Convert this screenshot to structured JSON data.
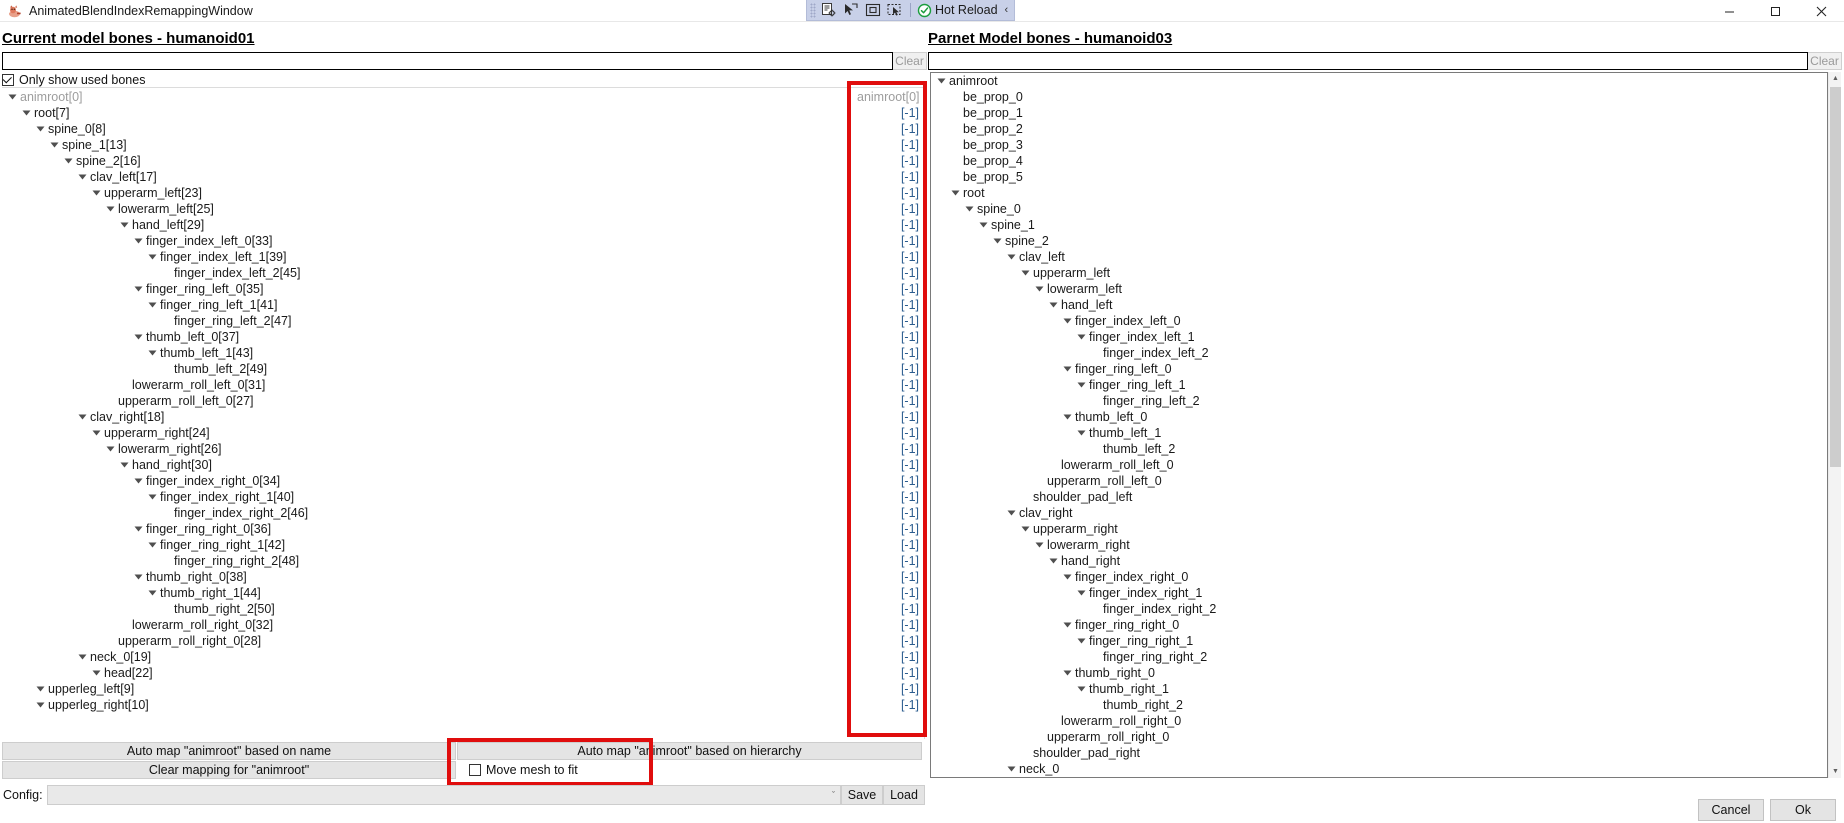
{
  "window": {
    "title": "AnimatedBlendIndexRemappingWindow",
    "icon": "app-icon",
    "minimize": "—",
    "maximize": "☐",
    "close": "✕"
  },
  "toolbar": {
    "buttons": [
      {
        "name": "select-element-icon",
        "label": ""
      },
      {
        "name": "pointer-icon",
        "label": ""
      },
      {
        "name": "frame-icon",
        "label": ""
      },
      {
        "name": "preview-selection-icon",
        "label": ""
      }
    ],
    "hot_reload": "Hot Reload",
    "overflow": "‹"
  },
  "left_panel": {
    "title": "Current model bones - humanoid01",
    "filter_value": "",
    "filter_placeholder": "",
    "clear_label": "Clear",
    "only_used_label": "Only show used bones",
    "only_used_checked": true,
    "tree": [
      {
        "label": "animroot[0]",
        "depth": 0,
        "arrow": true,
        "dim": true
      },
      {
        "label": "root[7]",
        "depth": 1,
        "arrow": true,
        "dim": false
      },
      {
        "label": "spine_0[8]",
        "depth": 2,
        "arrow": true,
        "dim": false
      },
      {
        "label": "spine_1[13]",
        "depth": 3,
        "arrow": true,
        "dim": false
      },
      {
        "label": "spine_2[16]",
        "depth": 4,
        "arrow": true,
        "dim": false
      },
      {
        "label": "clav_left[17]",
        "depth": 5,
        "arrow": true,
        "dim": false
      },
      {
        "label": "upperarm_left[23]",
        "depth": 6,
        "arrow": true,
        "dim": false
      },
      {
        "label": "lowerarm_left[25]",
        "depth": 7,
        "arrow": true,
        "dim": false
      },
      {
        "label": "hand_left[29]",
        "depth": 8,
        "arrow": true,
        "dim": false
      },
      {
        "label": "finger_index_left_0[33]",
        "depth": 9,
        "arrow": true,
        "dim": false
      },
      {
        "label": "finger_index_left_1[39]",
        "depth": 10,
        "arrow": true,
        "dim": false
      },
      {
        "label": "finger_index_left_2[45]",
        "depth": 11,
        "arrow": false,
        "dim": false
      },
      {
        "label": "finger_ring_left_0[35]",
        "depth": 9,
        "arrow": true,
        "dim": false
      },
      {
        "label": "finger_ring_left_1[41]",
        "depth": 10,
        "arrow": true,
        "dim": false
      },
      {
        "label": "finger_ring_left_2[47]",
        "depth": 11,
        "arrow": false,
        "dim": false
      },
      {
        "label": "thumb_left_0[37]",
        "depth": 9,
        "arrow": true,
        "dim": false
      },
      {
        "label": "thumb_left_1[43]",
        "depth": 10,
        "arrow": true,
        "dim": false
      },
      {
        "label": "thumb_left_2[49]",
        "depth": 11,
        "arrow": false,
        "dim": false
      },
      {
        "label": "lowerarm_roll_left_0[31]",
        "depth": 8,
        "arrow": false,
        "dim": false
      },
      {
        "label": "upperarm_roll_left_0[27]",
        "depth": 7,
        "arrow": false,
        "dim": false
      },
      {
        "label": "clav_right[18]",
        "depth": 5,
        "arrow": true,
        "dim": false
      },
      {
        "label": "upperarm_right[24]",
        "depth": 6,
        "arrow": true,
        "dim": false
      },
      {
        "label": "lowerarm_right[26]",
        "depth": 7,
        "arrow": true,
        "dim": false
      },
      {
        "label": "hand_right[30]",
        "depth": 8,
        "arrow": true,
        "dim": false
      },
      {
        "label": "finger_index_right_0[34]",
        "depth": 9,
        "arrow": true,
        "dim": false
      },
      {
        "label": "finger_index_right_1[40]",
        "depth": 10,
        "arrow": true,
        "dim": false
      },
      {
        "label": "finger_index_right_2[46]",
        "depth": 11,
        "arrow": false,
        "dim": false
      },
      {
        "label": "finger_ring_right_0[36]",
        "depth": 9,
        "arrow": true,
        "dim": false
      },
      {
        "label": "finger_ring_right_1[42]",
        "depth": 10,
        "arrow": true,
        "dim": false
      },
      {
        "label": "finger_ring_right_2[48]",
        "depth": 11,
        "arrow": false,
        "dim": false
      },
      {
        "label": "thumb_right_0[38]",
        "depth": 9,
        "arrow": true,
        "dim": false
      },
      {
        "label": "thumb_right_1[44]",
        "depth": 10,
        "arrow": true,
        "dim": false
      },
      {
        "label": "thumb_right_2[50]",
        "depth": 11,
        "arrow": false,
        "dim": false
      },
      {
        "label": "lowerarm_roll_right_0[32]",
        "depth": 8,
        "arrow": false,
        "dim": false
      },
      {
        "label": "upperarm_roll_right_0[28]",
        "depth": 7,
        "arrow": false,
        "dim": false
      },
      {
        "label": "neck_0[19]",
        "depth": 5,
        "arrow": true,
        "dim": false
      },
      {
        "label": "head[22]",
        "depth": 6,
        "arrow": true,
        "dim": false
      },
      {
        "label": "upperleg_left[9]",
        "depth": 2,
        "arrow": true,
        "dim": false
      },
      {
        "label": "upperleg_right[10]",
        "depth": 2,
        "arrow": true,
        "dim": false
      }
    ],
    "index_column": [
      {
        "label": "animroot[0]",
        "dim": true
      },
      {
        "label": "[-1]",
        "dim": false
      },
      {
        "label": "[-1]",
        "dim": false
      },
      {
        "label": "[-1]",
        "dim": false
      },
      {
        "label": "[-1]",
        "dim": false
      },
      {
        "label": "[-1]",
        "dim": false
      },
      {
        "label": "[-1]",
        "dim": false
      },
      {
        "label": "[-1]",
        "dim": false
      },
      {
        "label": "[-1]",
        "dim": false
      },
      {
        "label": "[-1]",
        "dim": false
      },
      {
        "label": "[-1]",
        "dim": false
      },
      {
        "label": "[-1]",
        "dim": false
      },
      {
        "label": "[-1]",
        "dim": false
      },
      {
        "label": "[-1]",
        "dim": false
      },
      {
        "label": "[-1]",
        "dim": false
      },
      {
        "label": "[-1]",
        "dim": false
      },
      {
        "label": "[-1]",
        "dim": false
      },
      {
        "label": "[-1]",
        "dim": false
      },
      {
        "label": "[-1]",
        "dim": false
      },
      {
        "label": "[-1]",
        "dim": false
      },
      {
        "label": "[-1]",
        "dim": false
      },
      {
        "label": "[-1]",
        "dim": false
      },
      {
        "label": "[-1]",
        "dim": false
      },
      {
        "label": "[-1]",
        "dim": false
      },
      {
        "label": "[-1]",
        "dim": false
      },
      {
        "label": "[-1]",
        "dim": false
      },
      {
        "label": "[-1]",
        "dim": false
      },
      {
        "label": "[-1]",
        "dim": false
      },
      {
        "label": "[-1]",
        "dim": false
      },
      {
        "label": "[-1]",
        "dim": false
      },
      {
        "label": "[-1]",
        "dim": false
      },
      {
        "label": "[-1]",
        "dim": false
      },
      {
        "label": "[-1]",
        "dim": false
      },
      {
        "label": "[-1]",
        "dim": false
      },
      {
        "label": "[-1]",
        "dim": false
      },
      {
        "label": "[-1]",
        "dim": false
      },
      {
        "label": "[-1]",
        "dim": false
      },
      {
        "label": "[-1]",
        "dim": false
      },
      {
        "label": "[-1]",
        "dim": false
      }
    ]
  },
  "right_panel": {
    "title": "Parnet Model bones - humanoid03",
    "filter_value": "",
    "filter_placeholder": "",
    "clear_label": "Clear",
    "tree": [
      {
        "label": "animroot",
        "depth": 0,
        "arrow": true
      },
      {
        "label": "be_prop_0",
        "depth": 1,
        "arrow": false
      },
      {
        "label": "be_prop_1",
        "depth": 1,
        "arrow": false
      },
      {
        "label": "be_prop_2",
        "depth": 1,
        "arrow": false
      },
      {
        "label": "be_prop_3",
        "depth": 1,
        "arrow": false
      },
      {
        "label": "be_prop_4",
        "depth": 1,
        "arrow": false
      },
      {
        "label": "be_prop_5",
        "depth": 1,
        "arrow": false
      },
      {
        "label": "root",
        "depth": 1,
        "arrow": true
      },
      {
        "label": "spine_0",
        "depth": 2,
        "arrow": true
      },
      {
        "label": "spine_1",
        "depth": 3,
        "arrow": true
      },
      {
        "label": "spine_2",
        "depth": 4,
        "arrow": true
      },
      {
        "label": "clav_left",
        "depth": 5,
        "arrow": true
      },
      {
        "label": "upperarm_left",
        "depth": 6,
        "arrow": true
      },
      {
        "label": "lowerarm_left",
        "depth": 7,
        "arrow": true
      },
      {
        "label": "hand_left",
        "depth": 8,
        "arrow": true
      },
      {
        "label": "finger_index_left_0",
        "depth": 9,
        "arrow": true
      },
      {
        "label": "finger_index_left_1",
        "depth": 10,
        "arrow": true
      },
      {
        "label": "finger_index_left_2",
        "depth": 11,
        "arrow": false
      },
      {
        "label": "finger_ring_left_0",
        "depth": 9,
        "arrow": true
      },
      {
        "label": "finger_ring_left_1",
        "depth": 10,
        "arrow": true
      },
      {
        "label": "finger_ring_left_2",
        "depth": 11,
        "arrow": false
      },
      {
        "label": "thumb_left_0",
        "depth": 9,
        "arrow": true
      },
      {
        "label": "thumb_left_1",
        "depth": 10,
        "arrow": true
      },
      {
        "label": "thumb_left_2",
        "depth": 11,
        "arrow": false
      },
      {
        "label": "lowerarm_roll_left_0",
        "depth": 8,
        "arrow": false
      },
      {
        "label": "upperarm_roll_left_0",
        "depth": 7,
        "arrow": false
      },
      {
        "label": "shoulder_pad_left",
        "depth": 6,
        "arrow": false
      },
      {
        "label": "clav_right",
        "depth": 5,
        "arrow": true
      },
      {
        "label": "upperarm_right",
        "depth": 6,
        "arrow": true
      },
      {
        "label": "lowerarm_right",
        "depth": 7,
        "arrow": true
      },
      {
        "label": "hand_right",
        "depth": 8,
        "arrow": true
      },
      {
        "label": "finger_index_right_0",
        "depth": 9,
        "arrow": true
      },
      {
        "label": "finger_index_right_1",
        "depth": 10,
        "arrow": true
      },
      {
        "label": "finger_index_right_2",
        "depth": 11,
        "arrow": false
      },
      {
        "label": "finger_ring_right_0",
        "depth": 9,
        "arrow": true
      },
      {
        "label": "finger_ring_right_1",
        "depth": 10,
        "arrow": true
      },
      {
        "label": "finger_ring_right_2",
        "depth": 11,
        "arrow": false
      },
      {
        "label": "thumb_right_0",
        "depth": 9,
        "arrow": true
      },
      {
        "label": "thumb_right_1",
        "depth": 10,
        "arrow": true
      },
      {
        "label": "thumb_right_2",
        "depth": 11,
        "arrow": false
      },
      {
        "label": "lowerarm_roll_right_0",
        "depth": 8,
        "arrow": false
      },
      {
        "label": "upperarm_roll_right_0",
        "depth": 7,
        "arrow": false
      },
      {
        "label": "shoulder_pad_right",
        "depth": 6,
        "arrow": false
      },
      {
        "label": "neck_0",
        "depth": 5,
        "arrow": true
      }
    ]
  },
  "actions": {
    "automap_name": "Auto map \"animroot\" based on name",
    "automap_hierarchy": "Auto map \"animroot\" based on hierarchy",
    "clear_mapping": "Clear mapping for \"animroot\"",
    "move_mesh_label": "Move mesh to fit",
    "move_mesh_checked": false
  },
  "config": {
    "label": "Config:",
    "value": "",
    "chevron": "ˇ",
    "save": "Save",
    "load": "Load"
  },
  "dialog": {
    "cancel": "Cancel",
    "ok": "Ok"
  },
  "colors": {
    "highlight_red": "#e00d0d",
    "toolbar_blue": "#c8d0e8",
    "index_blue": "#2c5d8f",
    "hot_reload_green": "#1c9e3e"
  }
}
